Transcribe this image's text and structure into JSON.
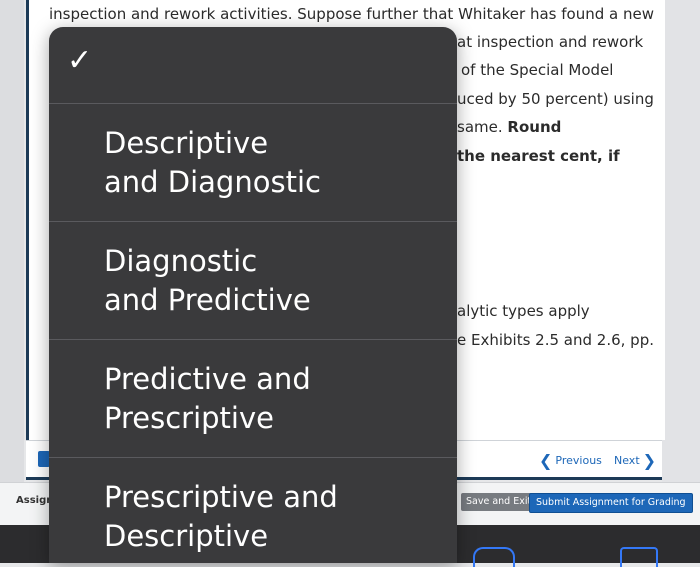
{
  "question": {
    "line1": "inspection and rework activities. Suppose further that Whitaker has found a new",
    "line2": "at inspection and rework",
    "line3": "of the Special Model",
    "line4": "uced by 50 percent) using",
    "line5_pre": "same.",
    "line5_bold": "Round",
    "line6_bold": "the nearest cent, if",
    "line7": "alytic types apply",
    "line8": "e Exhibits 2.5 and 2.6, pp."
  },
  "nav": {
    "previous_label": "Previous",
    "next_label": "Next"
  },
  "footer": {
    "assignment_label": "Assignm",
    "save_exit_label": "Save and Exit",
    "submit_label": "Submit Assignment for Grading"
  },
  "menu": {
    "checkmark": "✓",
    "items": [
      {
        "label_line1": "Descriptive",
        "label_line2": "and Diagnostic"
      },
      {
        "label_line1": "Diagnostic",
        "label_line2": "and Predictive"
      },
      {
        "label_line1": "Predictive and",
        "label_line2": "Prescriptive"
      },
      {
        "label_line1": "Prescriptive and",
        "label_line2": "Descriptive"
      }
    ]
  },
  "colors": {
    "link_blue": "#1d67b8",
    "menu_bg": "#3a3a3c",
    "frame_navy": "#1c3a57"
  },
  "icons": [
    "chevron-left-icon",
    "chevron-right-icon",
    "checkmark-icon"
  ]
}
